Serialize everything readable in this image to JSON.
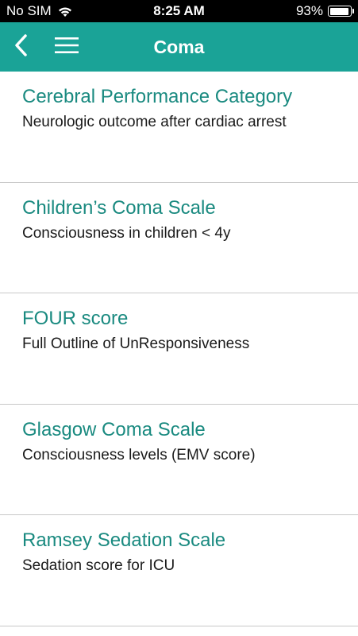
{
  "status_bar": {
    "carrier": "No SIM",
    "time": "8:25 AM",
    "battery": "93%",
    "battery_level": 0.93
  },
  "nav": {
    "title": "Coma",
    "color": "#1aa397"
  },
  "items": [
    {
      "title": "Cerebral Performance Category",
      "description": "Neurologic outcome after cardiac arrest"
    },
    {
      "title": "Children’s Coma Scale",
      "description": "Consciousness in children < 4y"
    },
    {
      "title": "FOUR score",
      "description": "Full Outline of UnResponsiveness"
    },
    {
      "title": "Glasgow Coma Scale",
      "description": "Consciousness levels (EMV score)"
    },
    {
      "title": "Ramsey Sedation Scale",
      "description": "Sedation score for ICU"
    }
  ]
}
